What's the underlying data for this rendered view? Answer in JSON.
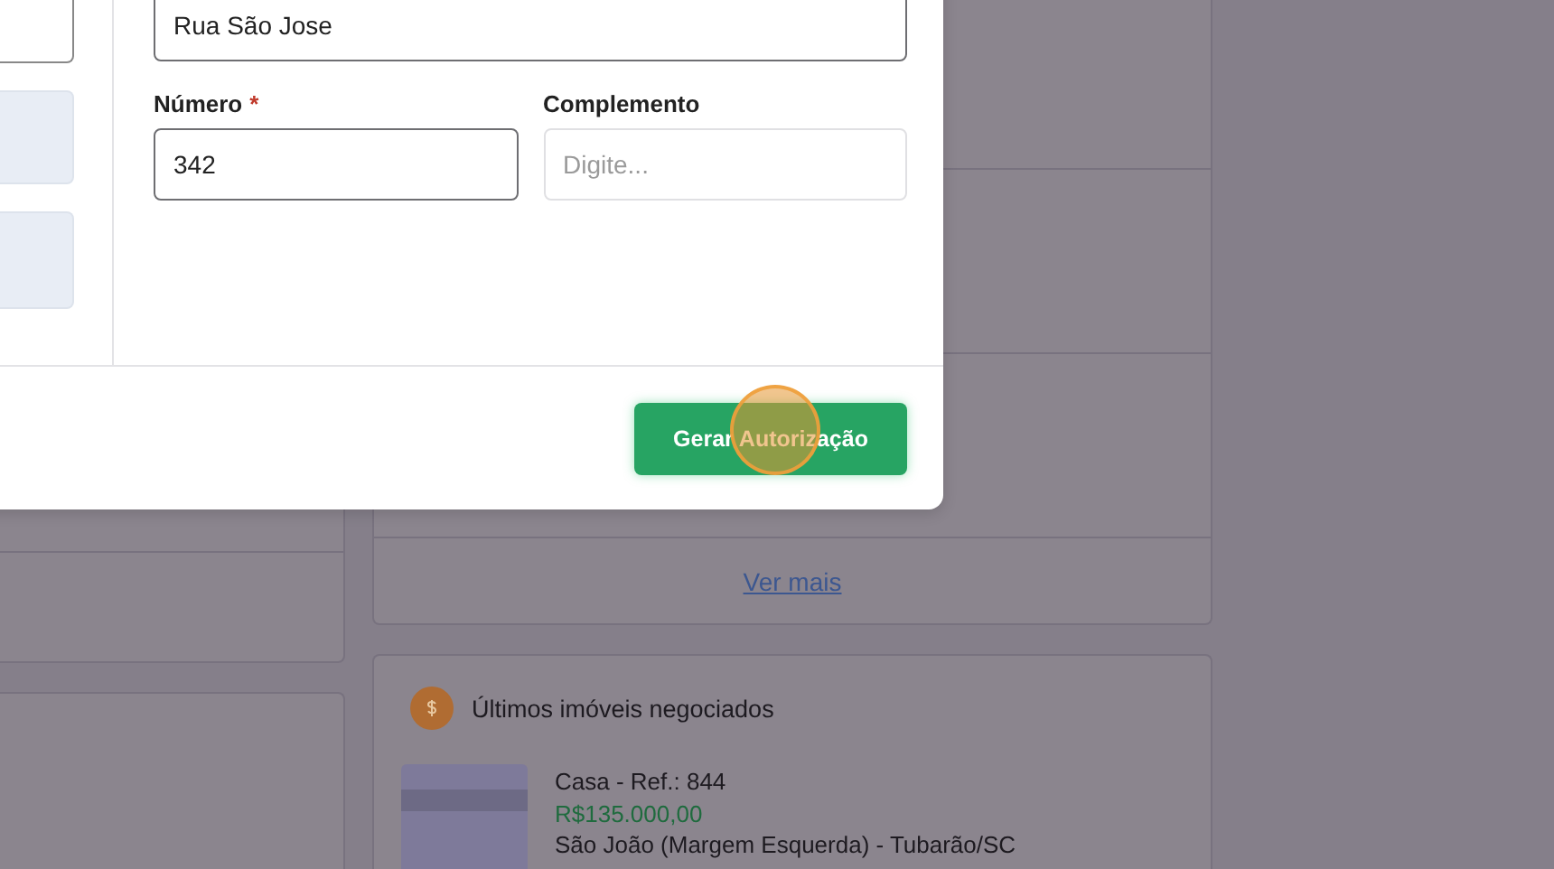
{
  "background": {
    "ver_mais_link": "Ver mais",
    "recent_deals": {
      "title": "Últimos imóveis negociados",
      "items": [
        {
          "title": "Casa - Ref.: 844",
          "price": "R$135.000,00",
          "location": "São João (Margem Esquerda) - Tubarão/SC"
        }
      ]
    }
  },
  "modal": {
    "street_field": {
      "value": "Rua São Jose"
    },
    "fields": [
      {
        "label": "Número",
        "required_mark": "*",
        "value": "342"
      },
      {
        "label": "Complemento",
        "placeholder": "Digite..."
      }
    ],
    "submit_button": {
      "label": "Gerar Autorização"
    }
  }
}
